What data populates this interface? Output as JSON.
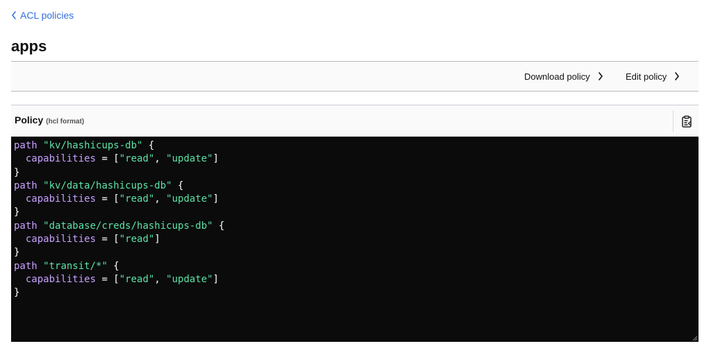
{
  "breadcrumb": {
    "label": "ACL policies"
  },
  "page": {
    "title": "apps"
  },
  "toolbar": {
    "download_label": "Download policy",
    "edit_label": "Edit policy"
  },
  "policy": {
    "label": "Policy",
    "format": "(hcl format)",
    "copy_icon": "clipboard-icon",
    "lines": [
      [
        {
          "t": "path ",
          "c": "kw"
        },
        {
          "t": "\"kv/hashicups-db\"",
          "c": "str"
        },
        {
          "t": " {",
          "c": "p"
        }
      ],
      [
        {
          "t": "  capabilities",
          "c": "kw"
        },
        {
          "t": " = [",
          "c": "p"
        },
        {
          "t": "\"read\"",
          "c": "str"
        },
        {
          "t": ", ",
          "c": "p"
        },
        {
          "t": "\"update\"",
          "c": "str"
        },
        {
          "t": "]",
          "c": "p"
        }
      ],
      [
        {
          "t": "}",
          "c": "p"
        }
      ],
      [
        {
          "t": "path ",
          "c": "kw"
        },
        {
          "t": "\"kv/data/hashicups-db\"",
          "c": "str"
        },
        {
          "t": " {",
          "c": "p"
        }
      ],
      [
        {
          "t": "  capabilities",
          "c": "kw"
        },
        {
          "t": " = [",
          "c": "p"
        },
        {
          "t": "\"read\"",
          "c": "str"
        },
        {
          "t": ", ",
          "c": "p"
        },
        {
          "t": "\"update\"",
          "c": "str"
        },
        {
          "t": "]",
          "c": "p"
        }
      ],
      [
        {
          "t": "}",
          "c": "p"
        }
      ],
      [
        {
          "t": "path ",
          "c": "kw"
        },
        {
          "t": "\"database/creds/hashicups-db\"",
          "c": "str"
        },
        {
          "t": " {",
          "c": "p"
        }
      ],
      [
        {
          "t": "  capabilities",
          "c": "kw"
        },
        {
          "t": " = [",
          "c": "p"
        },
        {
          "t": "\"read\"",
          "c": "str"
        },
        {
          "t": "]",
          "c": "p"
        }
      ],
      [
        {
          "t": "}",
          "c": "p"
        }
      ],
      [
        {
          "t": "path ",
          "c": "kw"
        },
        {
          "t": "\"transit/*\"",
          "c": "str"
        },
        {
          "t": " {",
          "c": "p"
        }
      ],
      [
        {
          "t": "  capabilities",
          "c": "kw"
        },
        {
          "t": " = [",
          "c": "p"
        },
        {
          "t": "\"read\"",
          "c": "str"
        },
        {
          "t": ", ",
          "c": "p"
        },
        {
          "t": "\"update\"",
          "c": "str"
        },
        {
          "t": "]",
          "c": "p"
        }
      ],
      [
        {
          "t": "}",
          "c": "p"
        }
      ]
    ]
  },
  "colors": {
    "link": "#2f6fde",
    "editor_bg": "#0b0b0c",
    "keyword": "#c9a0ff",
    "string": "#5ce2a5",
    "punct": "#ffffff"
  }
}
